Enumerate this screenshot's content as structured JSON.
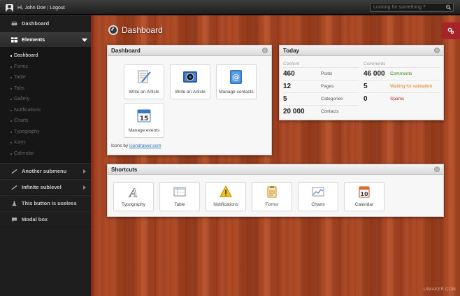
{
  "topbar": {
    "greeting": "Hi,",
    "user_name": "John Doe",
    "separator": "|",
    "logout_label": "Logout",
    "search_placeholder": "Looking for something ?"
  },
  "sidebar": {
    "items": [
      {
        "label": "Dashboard",
        "icon": "car-icon"
      },
      {
        "label": "Elements",
        "icon": "grid-icon",
        "active": true
      },
      {
        "label": "Another submenu",
        "icon": "brush-icon"
      },
      {
        "label": "Infinite sublevel",
        "icon": "brush-icon"
      },
      {
        "label": "This button is useless",
        "icon": "flask-icon"
      },
      {
        "label": "Modal box",
        "icon": "comment-icon"
      }
    ],
    "subitems": [
      "Dashboard",
      "Forms",
      "Table",
      "Tabs",
      "Gallery",
      "Notifications",
      "Charts",
      "Typography",
      "Icons",
      "Calendar"
    ]
  },
  "page": {
    "title": "Dashboard"
  },
  "dashboard_panel": {
    "title": "Dashboard",
    "tiles": [
      {
        "label": "Write an Article",
        "icon": "write-icon"
      },
      {
        "label": "Write an Article",
        "icon": "camera-icon"
      },
      {
        "label": "Manage contacts",
        "icon": "contacts-icon"
      },
      {
        "label": "Manage events",
        "icon": "calendar-icon"
      }
    ],
    "credit_prefix": "Icons by",
    "credit_link": "icondrawer.com"
  },
  "today_panel": {
    "title": "Today",
    "content_head": "Content",
    "comments_head": "Comments",
    "content_rows": [
      {
        "value": "460",
        "label": "Posts"
      },
      {
        "value": "12",
        "label": "Pages"
      },
      {
        "value": "5",
        "label": "Categories"
      },
      {
        "value": "20 000",
        "label": "Contacts"
      }
    ],
    "comment_rows": [
      {
        "value": "46 000",
        "label": "Comments",
        "color": "#3a8a1a"
      },
      {
        "value": "5",
        "label": "Waiting for validation",
        "color": "#e07a10"
      },
      {
        "value": "0",
        "label": "Spams",
        "color": "#c0241b"
      }
    ]
  },
  "shortcuts_panel": {
    "title": "Shortcuts",
    "items": [
      {
        "label": "Typography",
        "icon": "typography-icon"
      },
      {
        "label": "Table",
        "icon": "table-icon"
      },
      {
        "label": "Notifications",
        "icon": "warning-icon"
      },
      {
        "label": "Forms",
        "icon": "forms-icon"
      },
      {
        "label": "Charts",
        "icon": "chart-icon"
      },
      {
        "label": "Calendar",
        "icon": "calendar-icon"
      }
    ]
  },
  "calendar_icon_day": "15",
  "calendar_small_day": "10",
  "brand": "UIMAKER.COM",
  "colors": {
    "accent": "#a8222a",
    "link": "#2a7bc0"
  }
}
